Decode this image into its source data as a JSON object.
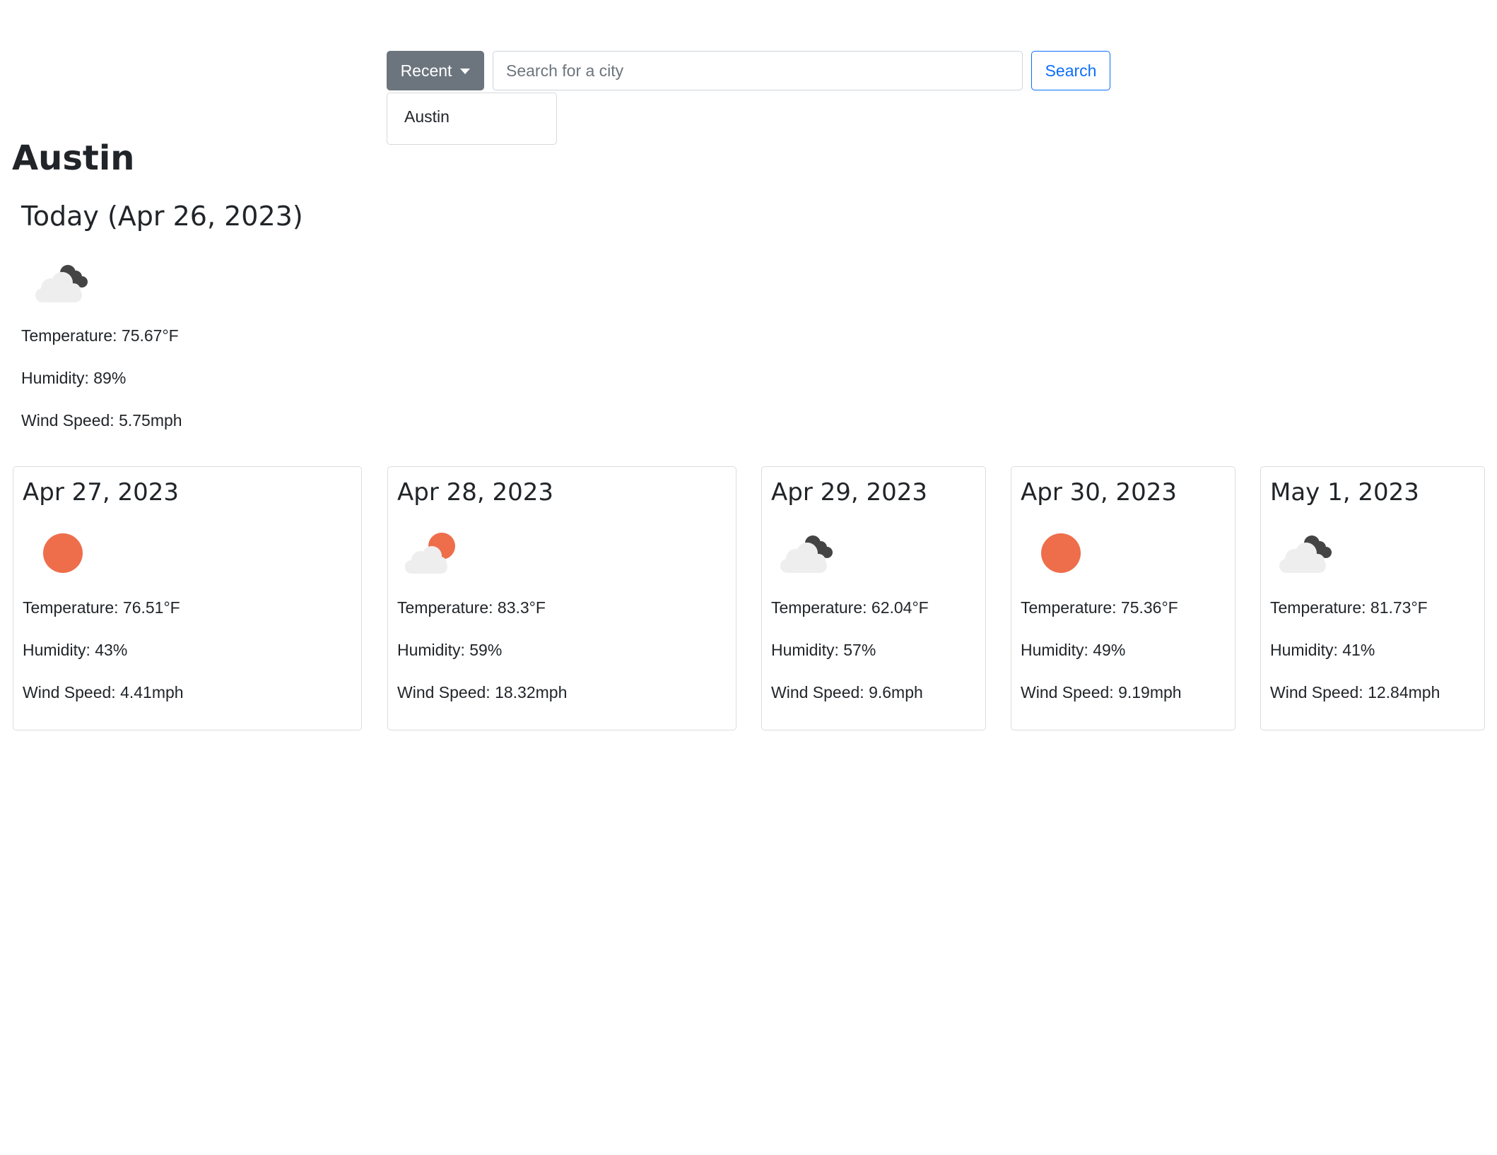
{
  "search": {
    "recent_label": "Recent",
    "placeholder": "Search for a city",
    "value": "",
    "search_label": "Search",
    "recent_items": [
      "Austin"
    ]
  },
  "city": "Austin",
  "today": {
    "title": "Today (Apr 26, 2023)",
    "icon": "partly-cloudy-night-icon",
    "temperature": "Temperature: 75.67°F",
    "humidity": "Humidity: 89%",
    "wind": "Wind Speed: 5.75mph"
  },
  "forecast": [
    {
      "date": "Apr 27, 2023",
      "icon": "sun-icon",
      "temperature": "Temperature: 76.51°F",
      "humidity": "Humidity: 43%",
      "wind": "Wind Speed: 4.41mph"
    },
    {
      "date": "Apr 28, 2023",
      "icon": "partly-cloudy-day-icon",
      "temperature": "Temperature: 83.3°F",
      "humidity": "Humidity: 59%",
      "wind": "Wind Speed: 18.32mph"
    },
    {
      "date": "Apr 29, 2023",
      "icon": "partly-cloudy-night-icon",
      "temperature": "Temperature: 62.04°F",
      "humidity": "Humidity: 57%",
      "wind": "Wind Speed: 9.6mph"
    },
    {
      "date": "Apr 30, 2023",
      "icon": "sun-icon",
      "temperature": "Temperature: 75.36°F",
      "humidity": "Humidity: 49%",
      "wind": "Wind Speed: 9.19mph"
    },
    {
      "date": "May 1, 2023",
      "icon": "partly-cloudy-night-icon",
      "temperature": "Temperature: 81.73°F",
      "humidity": "Humidity: 41%",
      "wind": "Wind Speed: 12.84mph"
    }
  ],
  "colors": {
    "sun": "#ee6e4b",
    "cloud": "#eeeeee",
    "moon_cloud": "#444444",
    "recent_button": "#6c757d",
    "search_button": "#0d6efd"
  }
}
